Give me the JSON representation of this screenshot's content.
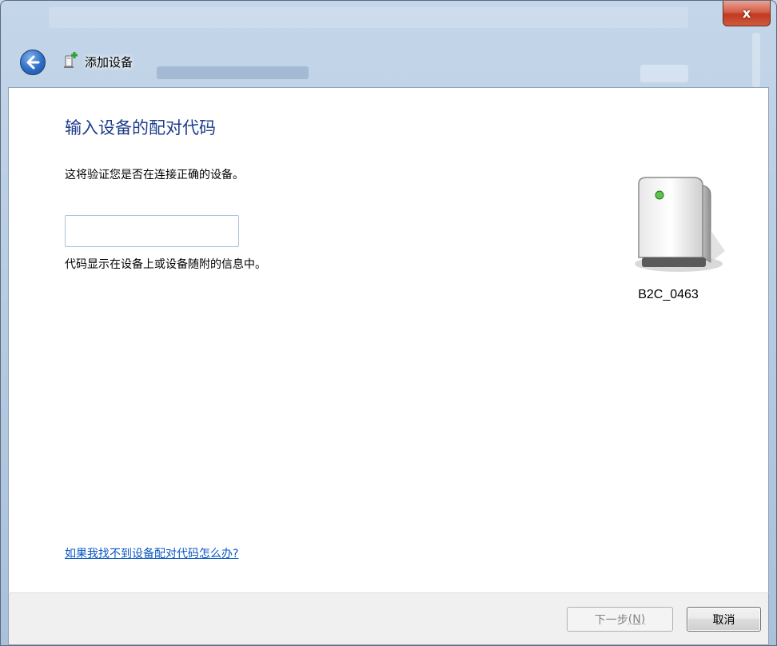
{
  "window": {
    "title": "添加设备",
    "close_label": "x"
  },
  "page": {
    "heading": "输入设备的配对代码",
    "description": "这将验证您是否在连接正确的设备。",
    "code_input": {
      "value": "",
      "placeholder": ""
    },
    "hint": "代码显示在设备上或设备随附的信息中。",
    "help_link": "如果我找不到设备配对代码怎么办?"
  },
  "device": {
    "name": "B2C_0463",
    "icon": "generic-device-icon"
  },
  "buttons": {
    "next_label": "下一步",
    "next_accel": "(N)",
    "cancel_label": "取消"
  },
  "colors": {
    "heading": "#1e3d8a",
    "link": "#0a57c2",
    "close": "#c03a22"
  }
}
